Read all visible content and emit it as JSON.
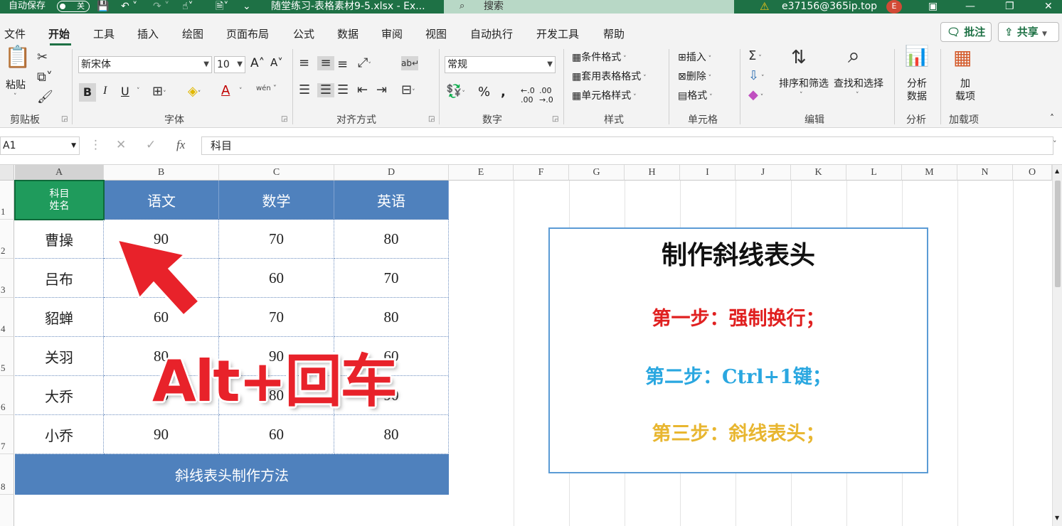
{
  "titlebar": {
    "autosave_label": "自动保存",
    "autosave_state": "关",
    "filename": "随堂练习-表格素材9-5.xlsx  -  Ex...",
    "search_placeholder": "搜索",
    "account": "e37156@365ip.top",
    "avatar_letter": "E"
  },
  "menu": {
    "items": [
      "文件",
      "开始",
      "工具",
      "插入",
      "绘图",
      "页面布局",
      "公式",
      "数据",
      "审阅",
      "视图",
      "自动执行",
      "开发工具",
      "帮助"
    ],
    "active": "开始",
    "comments_label": "批注",
    "share_label": "共享"
  },
  "ribbon": {
    "clipboard": {
      "paste": "粘贴",
      "group": "剪贴板"
    },
    "font": {
      "name": "新宋体",
      "size": "10",
      "group": "字体",
      "bold": "B",
      "italic": "I",
      "underline": "U",
      "grow": "A",
      "shrink": "A",
      "wen": "wén"
    },
    "alignment": {
      "group": "对齐方式"
    },
    "number": {
      "format": "常规",
      "group": "数字"
    },
    "styles": {
      "conditional": "条件格式",
      "table": "套用表格格式",
      "cell": "单元格样式",
      "group": "样式"
    },
    "cells": {
      "insert": "插入",
      "delete": "删除",
      "format": "格式",
      "group": "单元格"
    },
    "editing": {
      "sort": "排序和筛选",
      "find": "查找和选择",
      "group": "编辑"
    },
    "analysis": {
      "btn1": "分析",
      "btn2": "数据",
      "group": "分析"
    },
    "addins": {
      "btn1": "加",
      "btn2": "载项",
      "group": "加载项"
    }
  },
  "formula_bar": {
    "name_box": "A1",
    "fx": "fx",
    "content": "科目"
  },
  "sheet": {
    "columns": [
      "A",
      "B",
      "C",
      "D",
      "E",
      "F",
      "G",
      "H",
      "I",
      "J",
      "K",
      "L",
      "M",
      "N",
      "O"
    ],
    "rows": [
      "1",
      "2",
      "3",
      "4",
      "5",
      "6",
      "7",
      "8"
    ],
    "a1_line1": "科目",
    "a1_line2": "姓名",
    "headers": [
      "语文",
      "数学",
      "英语"
    ],
    "data": [
      {
        "name": "曹操",
        "b": "90",
        "c": "70",
        "d": "80"
      },
      {
        "name": "吕布",
        "b": "",
        "c": "60",
        "d": "70"
      },
      {
        "name": "貂蝉",
        "b": "60",
        "c": "70",
        "d": "80"
      },
      {
        "name": "关羽",
        "b": "80",
        "c": "90",
        "d": "60"
      },
      {
        "name": "大乔",
        "b": "70",
        "c": "80",
        "d": "90"
      },
      {
        "name": "小乔",
        "b": "90",
        "c": "60",
        "d": "80"
      }
    ],
    "footer": "斜线表头制作方法"
  },
  "instructions": {
    "title": "制作斜线表头",
    "step1": "第一步：强制换行；",
    "step2": "第二步：Ctrl+1键；",
    "step3": "第三步：斜线表头；",
    "colors": {
      "step1": "#e02020",
      "step2": "#2aa7e0",
      "step3": "#e8b630"
    }
  },
  "overlay": {
    "shortcut": "Alt+回车",
    "color": "#e8222a"
  }
}
